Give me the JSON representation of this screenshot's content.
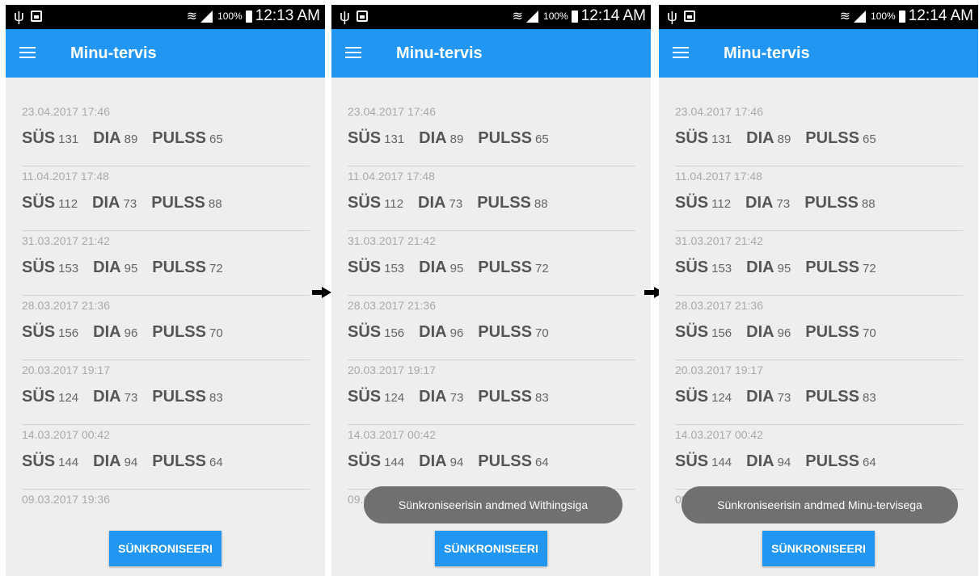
{
  "screens": [
    {
      "status": {
        "battery": "100%",
        "time": "12:13 AM"
      },
      "title": "Minu-tervis",
      "button": "SÜNKRONISEERI",
      "toast": ""
    },
    {
      "status": {
        "battery": "100%",
        "time": "12:14 AM"
      },
      "title": "Minu-tervis",
      "button": "SÜNKRONISEERI",
      "toast": "Sünkroniseerisin andmed Withingsiga"
    },
    {
      "status": {
        "battery": "100%",
        "time": "12:14 AM"
      },
      "title": "Minu-tervis",
      "button": "SÜNKRONISEERI",
      "toast": "Sünkroniseerisin andmed Minu-tervisega"
    }
  ],
  "labels": {
    "sys": "SÜS",
    "dia": "DIA",
    "pulse": "PULSS"
  },
  "readings": [
    {
      "date": "23.04.2017 17:46",
      "sys": "131",
      "dia": "89",
      "pulse": "65"
    },
    {
      "date": "11.04.2017 17:48",
      "sys": "112",
      "dia": "73",
      "pulse": "88"
    },
    {
      "date": "31.03.2017 21:42",
      "sys": "153",
      "dia": "95",
      "pulse": "72"
    },
    {
      "date": "28.03.2017 21:36",
      "sys": "156",
      "dia": "96",
      "pulse": "70"
    },
    {
      "date": "20.03.2017 19:17",
      "sys": "124",
      "dia": "73",
      "pulse": "83"
    },
    {
      "date": "14.03.2017 00:42",
      "sys": "144",
      "dia": "94",
      "pulse": "64"
    },
    {
      "date": "09.03.2017 19:36",
      "sys": "",
      "dia": "",
      "pulse": ""
    }
  ],
  "colors": {
    "appbar": "#2196f3",
    "background": "#eeeeee",
    "toast": "#6b6b6b"
  }
}
